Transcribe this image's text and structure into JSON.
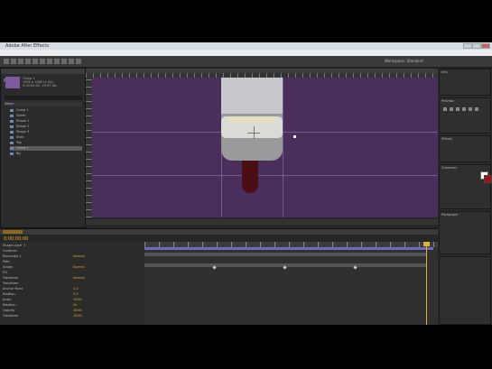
{
  "window": {
    "title": "Adobe After Effects"
  },
  "menu": [
    "File",
    "Edit",
    "Composition",
    "Layer",
    "Effect",
    "Animation",
    "View",
    "Window",
    "Help"
  ],
  "toolbar": {
    "workspace_label": "Workspace: Standard"
  },
  "project_panel": {
    "tab": "Project",
    "info_lines": [
      "Comp 1",
      "1920 x 1080 (1.00)",
      "0;00;05;00, 29.97 fps"
    ],
    "header": "Name",
    "items": [
      "Comp 1",
      "Solids",
      "Shape 1",
      "Shape 2",
      "Shape 3",
      "Stick",
      "Top",
      "Comp 1",
      "Bg"
    ]
  },
  "viewer": {
    "tab": "Composition: Comp 1",
    "footer_zoom": "50%",
    "footer_time": "0;00;00;00",
    "footer_res": "Full"
  },
  "timeline": {
    "time": "0;00;00;00",
    "tabs": [
      "Comp 1"
    ],
    "layers": [
      {
        "name": "Shape Layer 1",
        "value": ""
      },
      {
        "name": "Contents",
        "value": ""
      },
      {
        "name": "Rectangle 1",
        "value": "Normal"
      },
      {
        "name": "Path",
        "value": ""
      },
      {
        "name": "Stroke",
        "value": "Normal"
      },
      {
        "name": "Fill",
        "value": ""
      },
      {
        "name": "Transform",
        "value": "Normal"
      },
      {
        "name": "Transform",
        "value": ""
      },
      {
        "name": "Anchor Point",
        "value": "0.0"
      },
      {
        "name": "Position",
        "value": "0.0"
      },
      {
        "name": "Scale",
        "value": "100%"
      },
      {
        "name": "Rotation",
        "value": "0x"
      },
      {
        "name": "Opacity",
        "value": "100%"
      },
      {
        "name": "Transform",
        "value": "100%"
      }
    ]
  },
  "right_panel": {
    "info_tab": "Info",
    "preview_tab": "Preview",
    "effects_tab": "Effects",
    "paragraph_tab": "Paragraph",
    "character_tab": "Character"
  },
  "colors": {
    "comp_bg": "#4a2f5d",
    "fill_swatch": "#ffffff",
    "stroke_swatch": "#a31018",
    "accent": "#e0b030"
  }
}
